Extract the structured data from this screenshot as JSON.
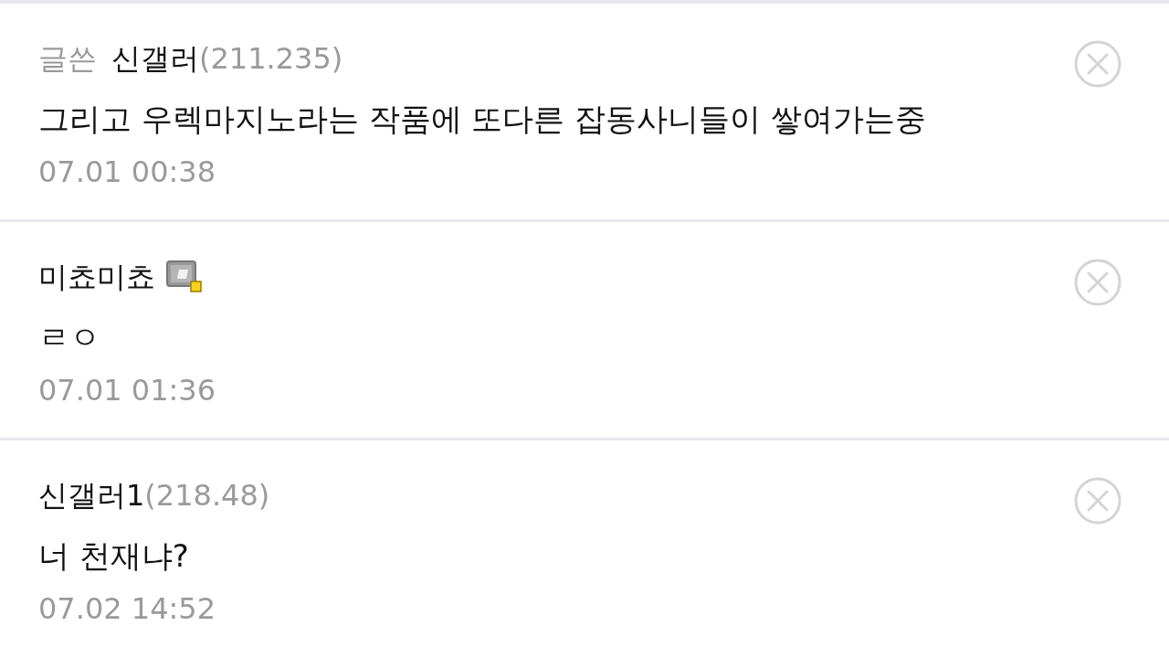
{
  "comments": [
    {
      "writer_tag": "글쓴",
      "name": "신갤러",
      "ip": "(211.235)",
      "badge": false,
      "text": "그리고 우렉마지노라는 작품에 또다른 잡동사니들이 쌓여가는중",
      "date": "07.01 00:38"
    },
    {
      "name": "미쵸미쵸",
      "badge": true,
      "text": "ㄹㅇ",
      "date": "07.01 01:36"
    },
    {
      "name": "신갤러1",
      "ip": "(218.48)",
      "badge": false,
      "text": "너 천재냐?",
      "date": "07.02 14:52"
    }
  ]
}
